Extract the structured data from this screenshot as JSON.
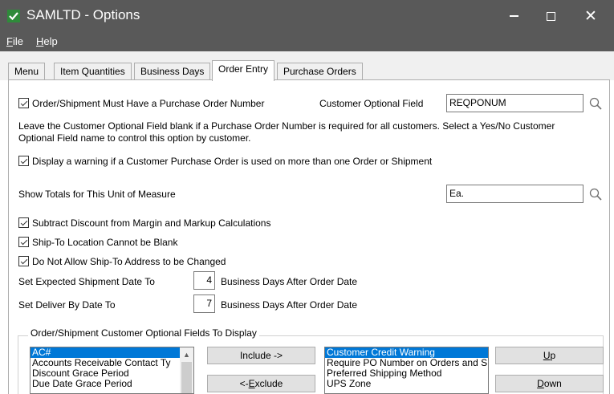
{
  "window": {
    "title": "SAMLTD - Options",
    "close_glyph": "✕"
  },
  "menubar": {
    "file_mnemonic": "F",
    "file_rest": "ile",
    "help_mnemonic": "H",
    "help_rest": "elp"
  },
  "tabs": [
    {
      "label": "Menu"
    },
    {
      "label": "Item Quantities"
    },
    {
      "label": "Business Days"
    },
    {
      "label": "Order Entry",
      "active": true
    },
    {
      "label": "Purchase Orders"
    }
  ],
  "order_entry": {
    "po_required": {
      "label": "Order/Shipment Must Have a Purchase Order Number",
      "checked": true
    },
    "customer_optional_field": {
      "label": "Customer Optional Field",
      "value": "REQPONUM"
    },
    "help_text_line1": "Leave the Customer Optional Field blank if a Purchase Order Number is required for all customers. Select a Yes/No Customer",
    "help_text_line2": "Optional Field name to control this option by customer.",
    "po_warning": {
      "label": "Display a warning if a Customer Purchase Order is used on more than one Order or Shipment",
      "checked": true
    },
    "totals_uom": {
      "label": "Show Totals for This Unit of Measure",
      "value": "Ea."
    },
    "subtract_discount": {
      "label": "Subtract Discount from Margin and Markup Calculations",
      "checked": true
    },
    "shipto_not_blank": {
      "label": "Ship-To Location Cannot be Blank",
      "checked": true
    },
    "shipto_no_change": {
      "label": "Do Not Allow Ship-To Address to be Changed",
      "checked": true
    },
    "expected_ship": {
      "label": "Set Expected Shipment Date To",
      "value": "4",
      "suffix": "Business Days After Order Date"
    },
    "deliver_by": {
      "label": "Set Deliver By Date To",
      "value": "7",
      "suffix": "Business Days After Order Date"
    }
  },
  "optional_fields_group": {
    "title": "Order/Shipment Customer Optional Fields To Display",
    "available": [
      {
        "label": "AC#",
        "selected": true
      },
      {
        "label": "Accounts Receivable Contact Ty"
      },
      {
        "label": "Discount Grace Period"
      },
      {
        "label": "Due Date Grace Period"
      }
    ],
    "selected": [
      {
        "label": "Customer Credit Warning",
        "selected": true
      },
      {
        "label": "Require PO Number on Orders and S"
      },
      {
        "label": "Preferred Shipping Method"
      },
      {
        "label": "UPS Zone"
      }
    ],
    "include_label": "Include ->",
    "exclude_prefix": "<- ",
    "exclude_mnemonic": "E",
    "exclude_rest": "xclude",
    "up_mnemonic": "U",
    "up_rest": "p",
    "down_mnemonic": "D",
    "down_rest": "own"
  },
  "colors": {
    "titlebar": "#595959",
    "selection": "#0078d7"
  }
}
